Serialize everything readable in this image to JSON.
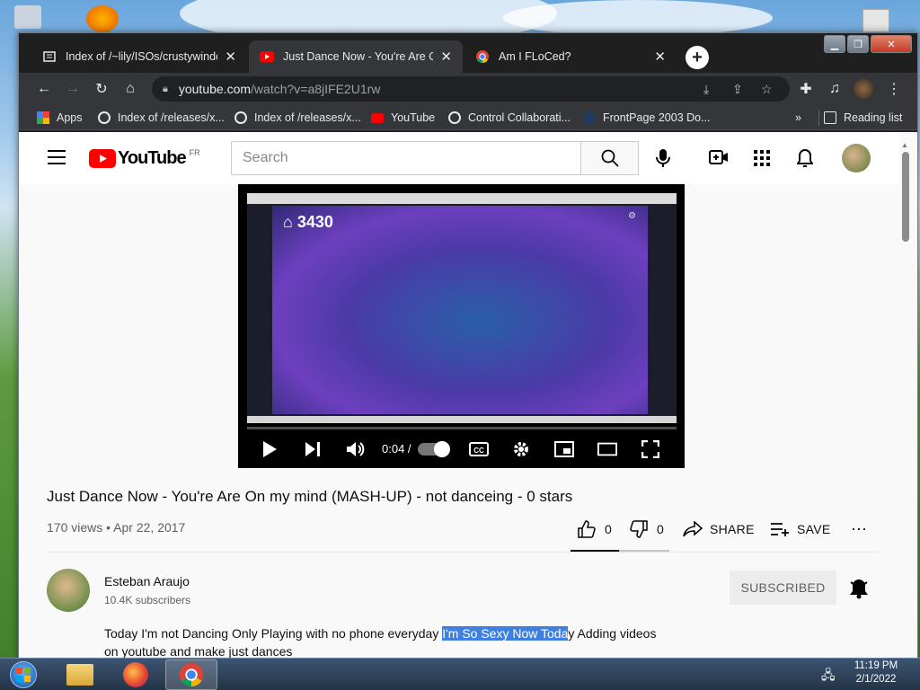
{
  "tabs": [
    {
      "title": "Index of /~lily/ISOs/crustywindo",
      "icon": "archive-icon"
    },
    {
      "title": "Just Dance Now - You're Are On",
      "icon": "youtube-icon"
    },
    {
      "title": "Am I FLoCed?",
      "icon": "chrome-icon"
    }
  ],
  "address": {
    "host": "youtube.com",
    "path": "/watch?v=a8jIFE2U1rw"
  },
  "bookmarks": [
    {
      "label": "Apps",
      "icon": "apps-grid-icon"
    },
    {
      "label": "Index of /releases/x...",
      "icon": "globe-icon"
    },
    {
      "label": "Index of /releases/x...",
      "icon": "globe-icon"
    },
    {
      "label": "YouTube",
      "icon": "youtube-icon"
    },
    {
      "label": "Control Collaborati...",
      "icon": "globe-icon"
    },
    {
      "label": "FrontPage 2003 Do...",
      "icon": "site-icon"
    }
  ],
  "reading_list": "Reading list",
  "yt": {
    "logo_text": "YouTube",
    "region": "FR",
    "search_placeholder": "Search"
  },
  "video": {
    "overlay_brand": "3430",
    "time": "0:04 /",
    "progress": 0.0
  },
  "title": "Just Dance Now - You're Are On my mind (MASH-UP) - not danceing - 0 stars",
  "meta": "170 views • Apr 22, 2017",
  "actions": {
    "likes": "0",
    "dislikes": "0",
    "share": "SHARE",
    "save": "SAVE"
  },
  "channel": {
    "name": "Esteban Araujo",
    "subscribers": "10.4K subscribers",
    "subscribe_label": "SUBSCRIBED"
  },
  "description": {
    "before": "Today I'm not Dancing Only Playing with no phone everyday ",
    "highlight": "I'm So Sexy Now Toda",
    "after": "y Adding videos",
    "line2": "on youtube and make just dances"
  },
  "clock": {
    "time": "11:19 PM",
    "date": "2/1/2022"
  },
  "colors": {
    "youtube_red": "#ff0000",
    "chrome_dark": "#202124",
    "highlight": "#3f7fe0"
  }
}
